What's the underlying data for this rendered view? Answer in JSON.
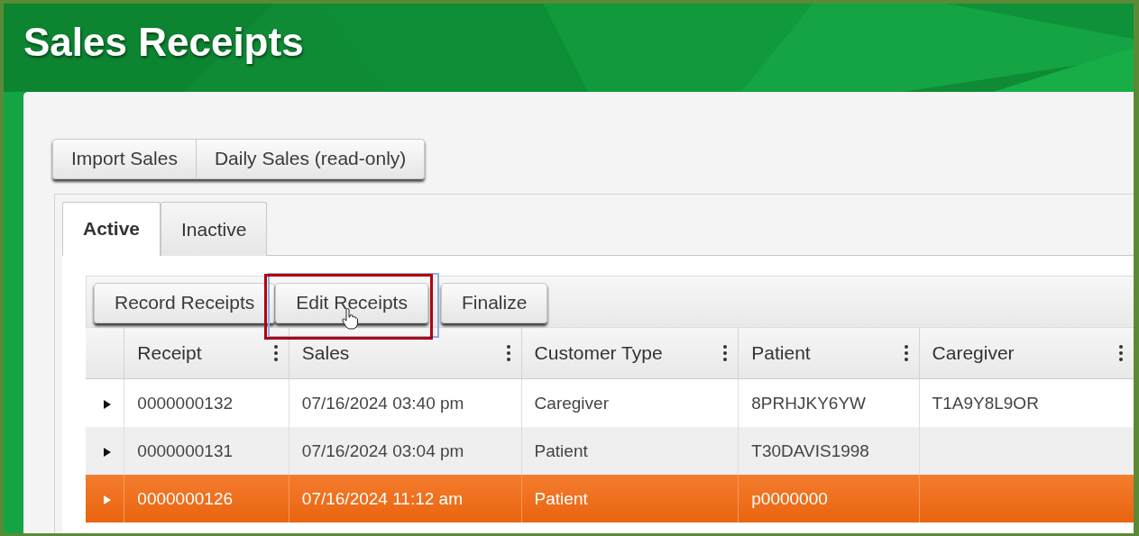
{
  "title": "Sales Receipts",
  "actions": [
    {
      "label": "Import Sales"
    },
    {
      "label": "Daily Sales (read-only)"
    }
  ],
  "tabs": [
    {
      "label": "Active",
      "selected": true
    },
    {
      "label": "Inactive",
      "selected": false
    }
  ],
  "toolbar": [
    [
      {
        "label": "Record Receipts",
        "highlighted": false
      },
      {
        "label": "Edit Receipts",
        "highlighted": true
      }
    ],
    [
      {
        "label": "Finalize",
        "highlighted": false
      }
    ]
  ],
  "table": {
    "columns": [
      "Receipt",
      "Sales",
      "Customer Type",
      "Patient",
      "Caregiver"
    ],
    "rows": [
      {
        "selected": false,
        "cells": [
          "0000000132",
          "07/16/2024 03:40 pm",
          "Caregiver",
          "8PRHJKY6YW",
          "T1A9Y8L9OR"
        ]
      },
      {
        "selected": false,
        "cells": [
          "0000000131",
          "07/16/2024 03:04 pm",
          "Patient",
          "T30DAVIS1998",
          null
        ]
      },
      {
        "selected": true,
        "cells": [
          "0000000126",
          "07/16/2024 11:12 am",
          "Patient",
          "p0000000",
          null
        ]
      }
    ]
  }
}
